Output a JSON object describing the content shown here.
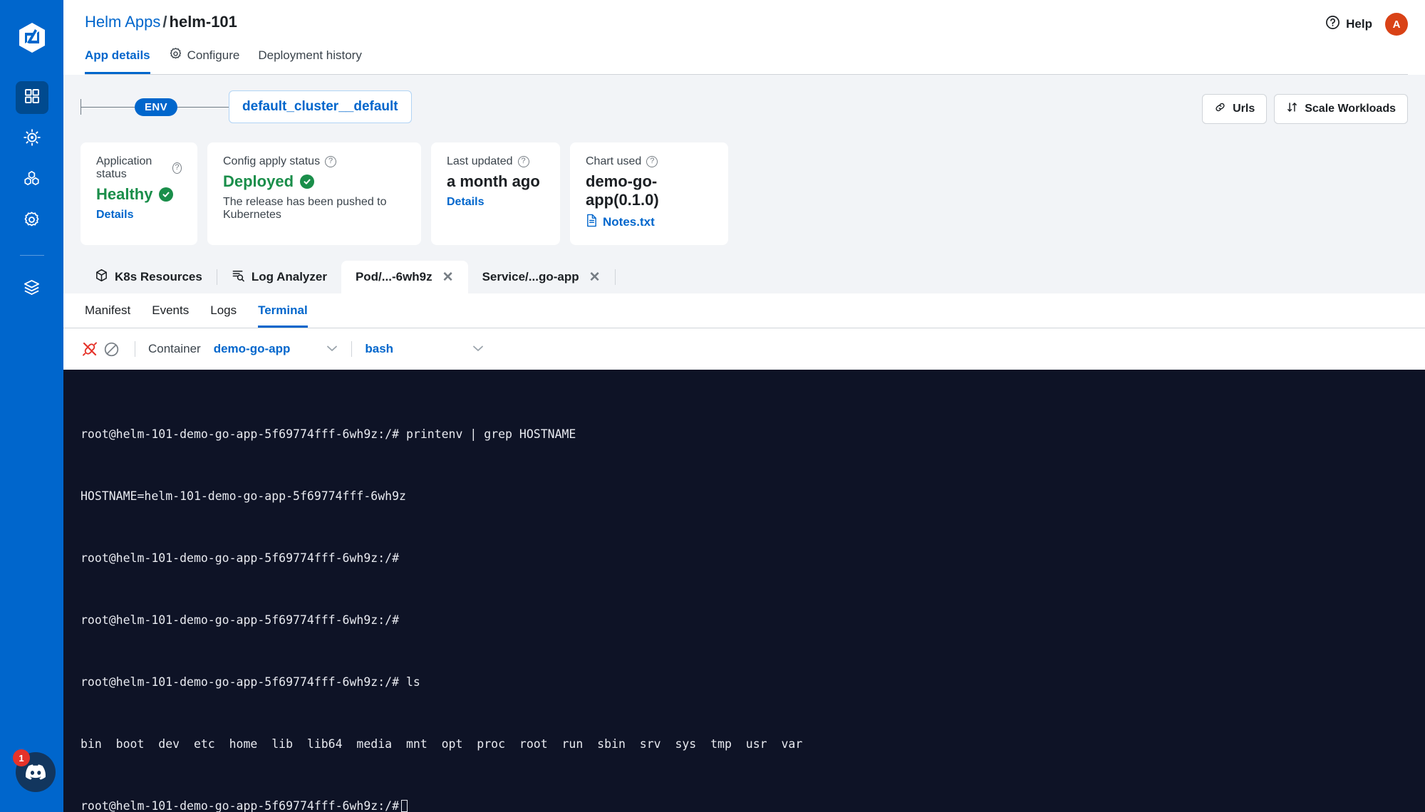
{
  "sidebar": {
    "logo_name": "devtron-logo",
    "items": [
      {
        "icon": "grid-apps-icon",
        "name": "applications",
        "active": true
      },
      {
        "icon": "ship-wheel-icon",
        "name": "charts",
        "active": false
      },
      {
        "icon": "cluster-hex-icon",
        "name": "resource-browser",
        "active": false
      },
      {
        "icon": "gear-icon",
        "name": "global-configurations",
        "active": false
      },
      {
        "icon": "stack-layers-icon",
        "name": "stack-manager",
        "active": false
      }
    ],
    "discord": {
      "icon": "discord-icon",
      "badge": "1"
    }
  },
  "header": {
    "breadcrumb": {
      "root": "Helm Apps",
      "separator": "/",
      "current": "helm-101"
    },
    "help_label": "Help",
    "help_icon": "question-circle-icon",
    "avatar_initial": "A",
    "tabs": [
      {
        "label": "App details",
        "icon": null,
        "active": true
      },
      {
        "label": "Configure",
        "icon": "gear-icon",
        "active": false
      },
      {
        "label": "Deployment history",
        "icon": null,
        "active": false
      }
    ]
  },
  "env_row": {
    "pill": "ENV",
    "env_name": "default_cluster__default",
    "actions": [
      {
        "label": "Urls",
        "icon": "link-icon"
      },
      {
        "label": "Scale Workloads",
        "icon": "arrows-up-down-icon"
      }
    ]
  },
  "cards": [
    {
      "label": "Application status",
      "help_icon": "question-circle-icon",
      "value": "Healthy",
      "value_color": "#1a8e4a",
      "status_icon": "check-circle-icon",
      "sub": null,
      "link": "Details",
      "file_link": null
    },
    {
      "label": "Config apply status",
      "help_icon": "question-circle-icon",
      "value": "Deployed",
      "value_color": "#1a8e4a",
      "status_icon": "check-circle-icon",
      "sub": "The release has been pushed to Kubernetes",
      "link": null,
      "file_link": null
    },
    {
      "label": "Last updated",
      "help_icon": "question-circle-icon",
      "value": "a month ago",
      "value_color": "#1b1f23",
      "status_icon": null,
      "sub": null,
      "link": "Details",
      "file_link": null
    },
    {
      "label": "Chart used",
      "help_icon": "question-circle-icon",
      "value": "demo-go-app(0.1.0)",
      "value_color": "#1b1f23",
      "status_icon": null,
      "sub": null,
      "link": null,
      "file_link": "Notes.txt"
    }
  ],
  "resource_tabs": [
    {
      "label": "K8s Resources",
      "icon": "cube-icon",
      "active": false,
      "closable": false
    },
    {
      "label": "Log Analyzer",
      "icon": "log-search-icon",
      "active": false,
      "closable": false
    },
    {
      "label": "Pod/...-6wh9z",
      "icon": null,
      "active": true,
      "closable": true
    },
    {
      "label": "Service/...go-app",
      "icon": null,
      "active": false,
      "closable": true
    }
  ],
  "sub_tabs": [
    {
      "label": "Manifest",
      "active": false
    },
    {
      "label": "Events",
      "active": false
    },
    {
      "label": "Logs",
      "active": false
    },
    {
      "label": "Terminal",
      "active": true
    }
  ],
  "terminal_bar": {
    "disconnect_icon": "plug-disconnect-icon",
    "clear_icon": "no-entry-icon",
    "container_label": "Container",
    "container_value": "demo-go-app",
    "shell_value": "bash",
    "chevron_icon": "chevron-down-icon"
  },
  "terminal": {
    "lines": [
      "root@helm-101-demo-go-app-5f69774fff-6wh9z:/# printenv | grep HOSTNAME",
      "HOSTNAME=helm-101-demo-go-app-5f69774fff-6wh9z",
      "root@helm-101-demo-go-app-5f69774fff-6wh9z:/#",
      "root@helm-101-demo-go-app-5f69774fff-6wh9z:/#",
      "root@helm-101-demo-go-app-5f69774fff-6wh9z:/# ls",
      "bin  boot  dev  etc  home  lib  lib64  media  mnt  opt  proc  root  run  sbin  srv  sys  tmp  usr  var"
    ],
    "prompt": "root@helm-101-demo-go-app-5f69774fff-6wh9z:/#",
    "background": "#0e1326",
    "foreground": "#e8eaf0"
  },
  "colors": {
    "brand_blue": "#0066cc",
    "sidebar_active": "#004a8f",
    "green": "#1a8e4a",
    "avatar_orange": "#d94216",
    "badge_red": "#e5332a",
    "panel_bg": "#f2f4f7"
  }
}
